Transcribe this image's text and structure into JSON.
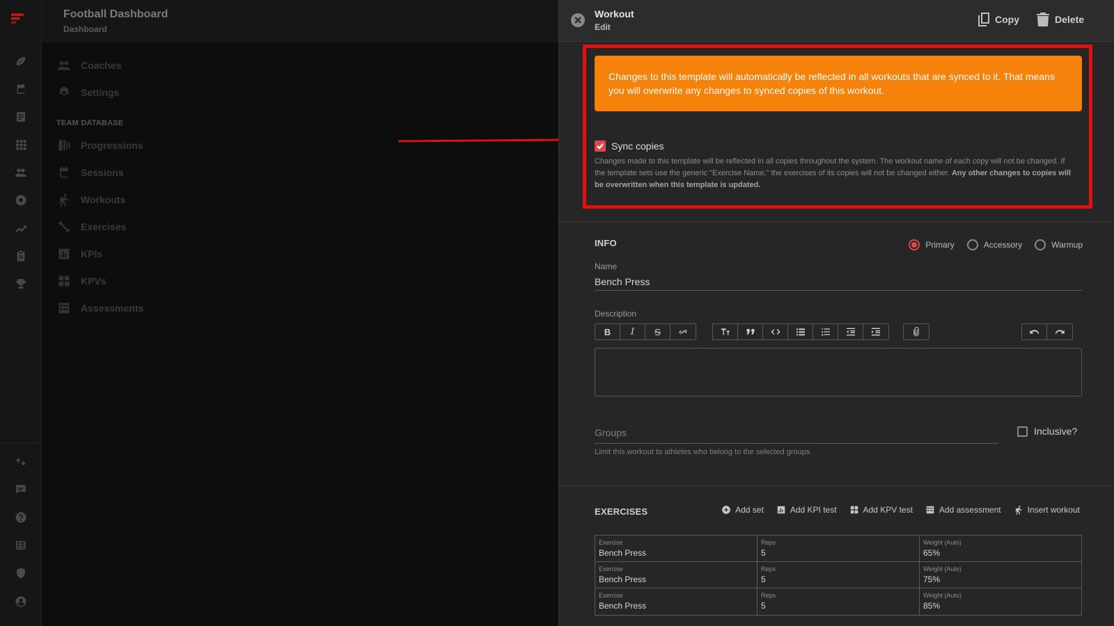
{
  "app": {
    "title": "Football Dashboard",
    "subtitle": "Dashboard"
  },
  "menu": {
    "items": [
      {
        "label": "Coaches",
        "icon": "people-icon"
      },
      {
        "label": "Settings",
        "icon": "gear-icon"
      }
    ],
    "section_label": "TEAM DATABASE",
    "db_items": [
      {
        "label": "Progressions",
        "icon": "progressions-icon"
      },
      {
        "label": "Sessions",
        "icon": "calendar-icon"
      },
      {
        "label": "Workouts",
        "icon": "running-icon"
      },
      {
        "label": "Exercises",
        "icon": "dumbbell-icon"
      },
      {
        "label": "KPIs",
        "icon": "chart-icon"
      },
      {
        "label": "KPVs",
        "icon": "grid-icon"
      },
      {
        "label": "Assessments",
        "icon": "checklist-icon"
      }
    ]
  },
  "drawer": {
    "title": "Workout",
    "subtitle": "Edit",
    "copy_label": "Copy",
    "delete_label": "Delete",
    "warning": "Changes to this template will automatically be reflected in all workouts that are synced to it. That means you will overwrite any changes to synced copies of this workout.",
    "sync_label": "Sync copies",
    "sync_checked": true,
    "sync_help": "Changes made to this template will be reflected in all copies throughout the system. The workout name of each copy will not be changed. If the template sets use the generic \"Exercise Name,\" the exercises of its copies will not be changed either.",
    "sync_help_bold": "Any other changes to copies will be overwritten when this template is updated.",
    "info_title": "INFO",
    "types": [
      {
        "label": "Primary",
        "selected": true
      },
      {
        "label": "Accessory",
        "selected": false
      },
      {
        "label": "Warmup",
        "selected": false
      }
    ],
    "name_label": "Name",
    "name_value": "Bench Press",
    "description_label": "Description",
    "groups_placeholder": "Groups",
    "groups_help": "Limit this workout to athletes who belong to the selected groups",
    "inclusive_label": "Inclusive?",
    "exercises_title": "EXERCISES",
    "actions": {
      "add_set": "Add set",
      "add_kpi": "Add KPI test",
      "add_kpv": "Add KPV test",
      "add_assessment": "Add assessment",
      "insert_workout": "Insert workout"
    },
    "exercise_rows": [
      {
        "exercise_label": "Exercise",
        "exercise": "Bench Press",
        "reps_label": "Reps",
        "reps": "5",
        "weight_label": "Weight (Auto)",
        "weight": "65%"
      },
      {
        "exercise_label": "Exercise",
        "exercise": "Bench Press",
        "reps_label": "Reps",
        "reps": "5",
        "weight_label": "Weight (Auto)",
        "weight": "75%"
      },
      {
        "exercise_label": "Exercise",
        "exercise": "Bench Press",
        "reps_label": "Reps",
        "reps": "5",
        "weight_label": "Weight (Auto)",
        "weight": "85%"
      }
    ]
  },
  "colors": {
    "accent": "#e0484c",
    "warning": "#f5820a",
    "highlight": "#e01010"
  }
}
